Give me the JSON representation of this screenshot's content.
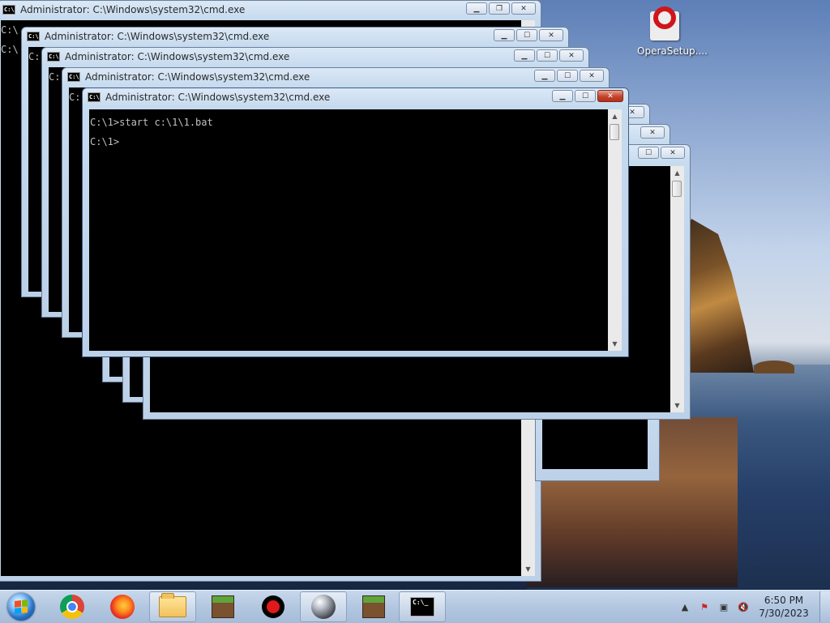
{
  "windows": {
    "title": "Administrator: C:\\Windows\\system32\\cmd.exe",
    "prompt_fragment": "C:\\",
    "prompt_fragment_short": "C:",
    "front": {
      "line1": "C:\\1>start c:\\1\\1.bat",
      "line2": "C:\\1>"
    }
  },
  "desktop": {
    "icon_label": "OperaSetup...."
  },
  "taskbar": {
    "time": "6:50 PM",
    "date": "7/30/2023",
    "cmd_icon_text": "C:\\_"
  },
  "colors": {
    "console_bg": "#000000",
    "console_fg": "#c0c0c0",
    "close_red": "#c4442b"
  }
}
